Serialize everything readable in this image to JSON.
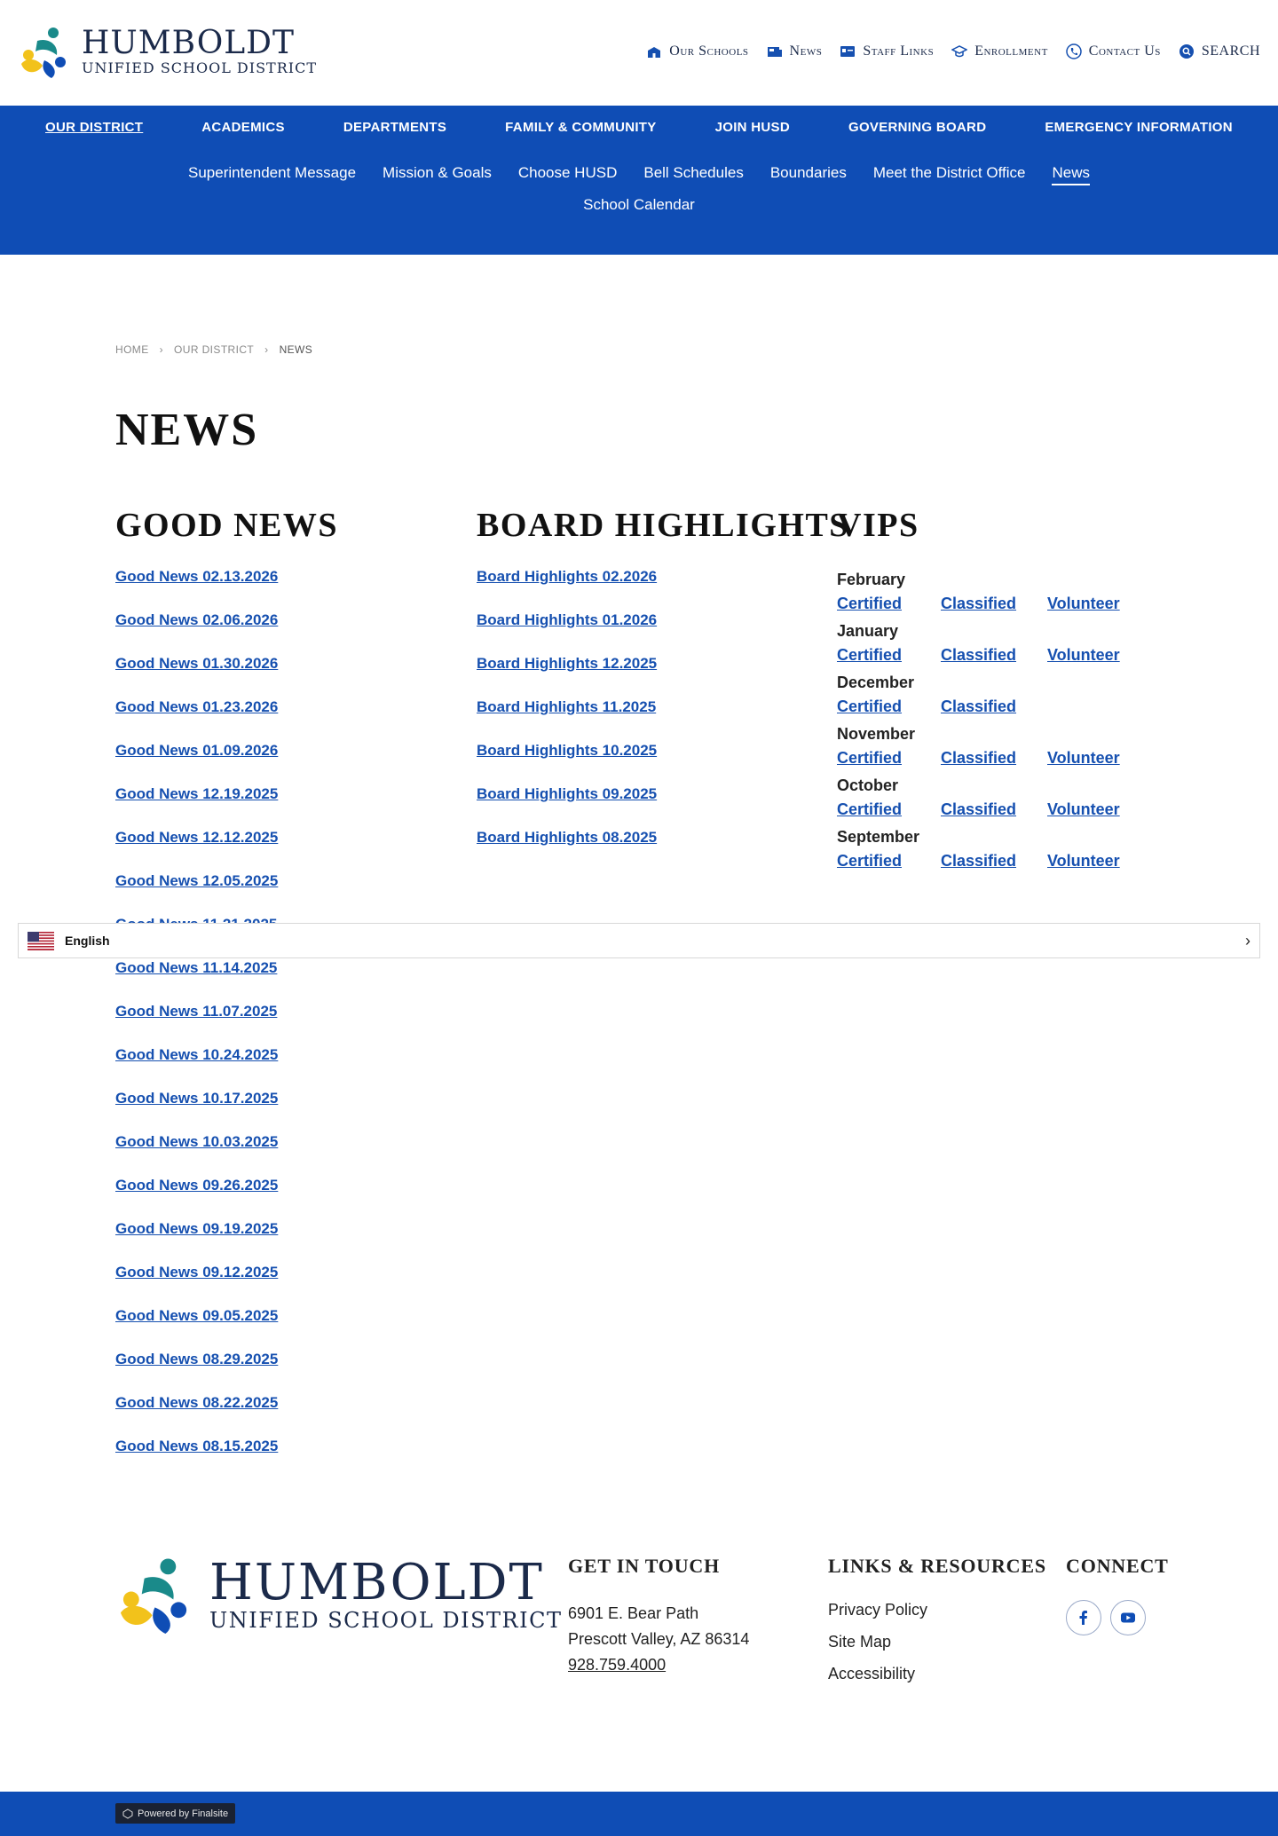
{
  "brand": {
    "name": "HUMBOLDT",
    "subtitle": "UNIFIED SCHOOL DISTRICT",
    "colors": {
      "primary": "#0f4db5",
      "teal": "#1a8a8a",
      "gold": "#f2c21b",
      "link": "#1650b0"
    }
  },
  "utility_nav": [
    {
      "label": "Our Schools",
      "icon": "school-icon"
    },
    {
      "label": "News",
      "icon": "news-icon"
    },
    {
      "label": "Staff Links",
      "icon": "id-card-icon"
    },
    {
      "label": "Enrollment",
      "icon": "graduation-cap-icon"
    },
    {
      "label": "Contact Us",
      "icon": "phone-icon"
    },
    {
      "label": "SEARCH",
      "icon": "search-icon"
    }
  ],
  "main_nav": [
    {
      "label": "OUR DISTRICT",
      "active": true
    },
    {
      "label": "ACADEMICS"
    },
    {
      "label": "DEPARTMENTS"
    },
    {
      "label": "FAMILY & COMMUNITY"
    },
    {
      "label": "JOIN HUSD"
    },
    {
      "label": "GOVERNING BOARD"
    },
    {
      "label": "EMERGENCY INFORMATION"
    }
  ],
  "sub_nav": [
    {
      "label": "Superintendent Message"
    },
    {
      "label": "Mission & Goals"
    },
    {
      "label": "Choose HUSD"
    },
    {
      "label": "Bell Schedules"
    },
    {
      "label": "Boundaries"
    },
    {
      "label": "Meet the District Office"
    },
    {
      "label": "News",
      "active": true
    },
    {
      "label": "School Calendar"
    }
  ],
  "breadcrumb": [
    "HOME",
    "OUR DISTRICT",
    "NEWS"
  ],
  "page_title": "NEWS",
  "good_news": {
    "heading": "GOOD NEWS",
    "items": [
      "Good News 02.13.2026",
      "Good News 02.06.2026",
      "Good News 01.30.2026",
      "Good News 01.23.2026",
      "Good News 01.09.2026",
      "Good News 12.19.2025",
      "Good News 12.12.2025",
      "Good News 12.05.2025",
      "Good News 11.21.2025",
      "Good News 11.14.2025",
      "Good News 11.07.2025",
      "Good News 10.24.2025",
      "Good News 10.17.2025",
      "Good News 10.03.2025",
      "Good News 09.26.2025",
      "Good News 09.19.2025",
      "Good News 09.12.2025",
      "Good News 09.05.2025",
      "Good News 08.29.2025",
      "Good News 08.22.2025",
      "Good News 08.15.2025"
    ]
  },
  "board_highlights": {
    "heading": "BOARD HIGHLIGHTS",
    "items": [
      "Board Highlights 02.2026",
      "Board Highlights 01.2026",
      "Board Highlights 12.2025",
      "Board Highlights 11.2025",
      "Board Highlights 10.2025",
      "Board Highlights 09.2025",
      "Board Highlights 08.2025"
    ]
  },
  "vips": {
    "heading": "VIPS",
    "months": [
      {
        "month": "February",
        "links": [
          "Certified",
          "Classified",
          "Volunteer"
        ]
      },
      {
        "month": "January",
        "links": [
          "Certified",
          "Classified",
          "Volunteer"
        ]
      },
      {
        "month": "December",
        "links": [
          "Certified",
          "Classified"
        ]
      },
      {
        "month": "November",
        "links": [
          "Certified",
          "Classified",
          "Volunteer"
        ]
      },
      {
        "month": "October",
        "links": [
          "Certified",
          "Classified",
          "Volunteer"
        ]
      },
      {
        "month": "September",
        "links": [
          "Certified",
          "Classified",
          "Volunteer"
        ]
      }
    ]
  },
  "language_bar": {
    "label": "English",
    "flag": "us-flag-icon"
  },
  "footer": {
    "get_in_touch": {
      "heading": "GET IN TOUCH",
      "address_line1": "6901 E. Bear Path",
      "address_line2": "Prescott Valley,  AZ  86314",
      "phone": "928.759.4000"
    },
    "links": {
      "heading": "LINKS & RESOURCES",
      "items": [
        "Privacy Policy",
        "Site Map",
        "Accessibility"
      ]
    },
    "connect": {
      "heading": "CONNECT",
      "icons": [
        "facebook-icon",
        "youtube-icon"
      ]
    },
    "powered_by": "Powered by Finalsite"
  }
}
